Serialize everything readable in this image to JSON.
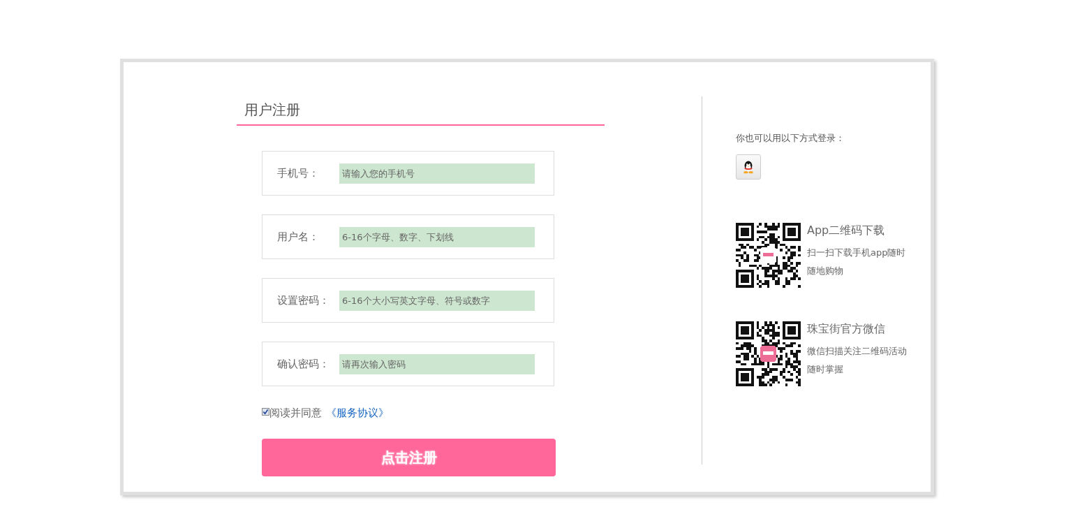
{
  "title": "用户注册",
  "fields": [
    {
      "label": "手机号：",
      "placeholder": "请输入您的手机号"
    },
    {
      "label": "用户名：",
      "placeholder": "6-16个字母、数字、下划线"
    },
    {
      "label": "设置密码：",
      "placeholder": "6-16个大小写英文字母、符号或数字"
    },
    {
      "label": "确认密码：",
      "placeholder": "请再次输入密码"
    }
  ],
  "agreement": {
    "checked": true,
    "text": "阅读并同意",
    "link": "《服务协议》"
  },
  "submit": "点击注册",
  "side": {
    "login_hint": "你也可以用以下方式登录：",
    "qr_blocks": [
      {
        "title": "App二维码下载",
        "text": "扫一扫下载手机app随时随地购物"
      },
      {
        "title": "珠宝街官方微信",
        "text": "微信扫描关注二维码活动随时掌握"
      }
    ]
  }
}
